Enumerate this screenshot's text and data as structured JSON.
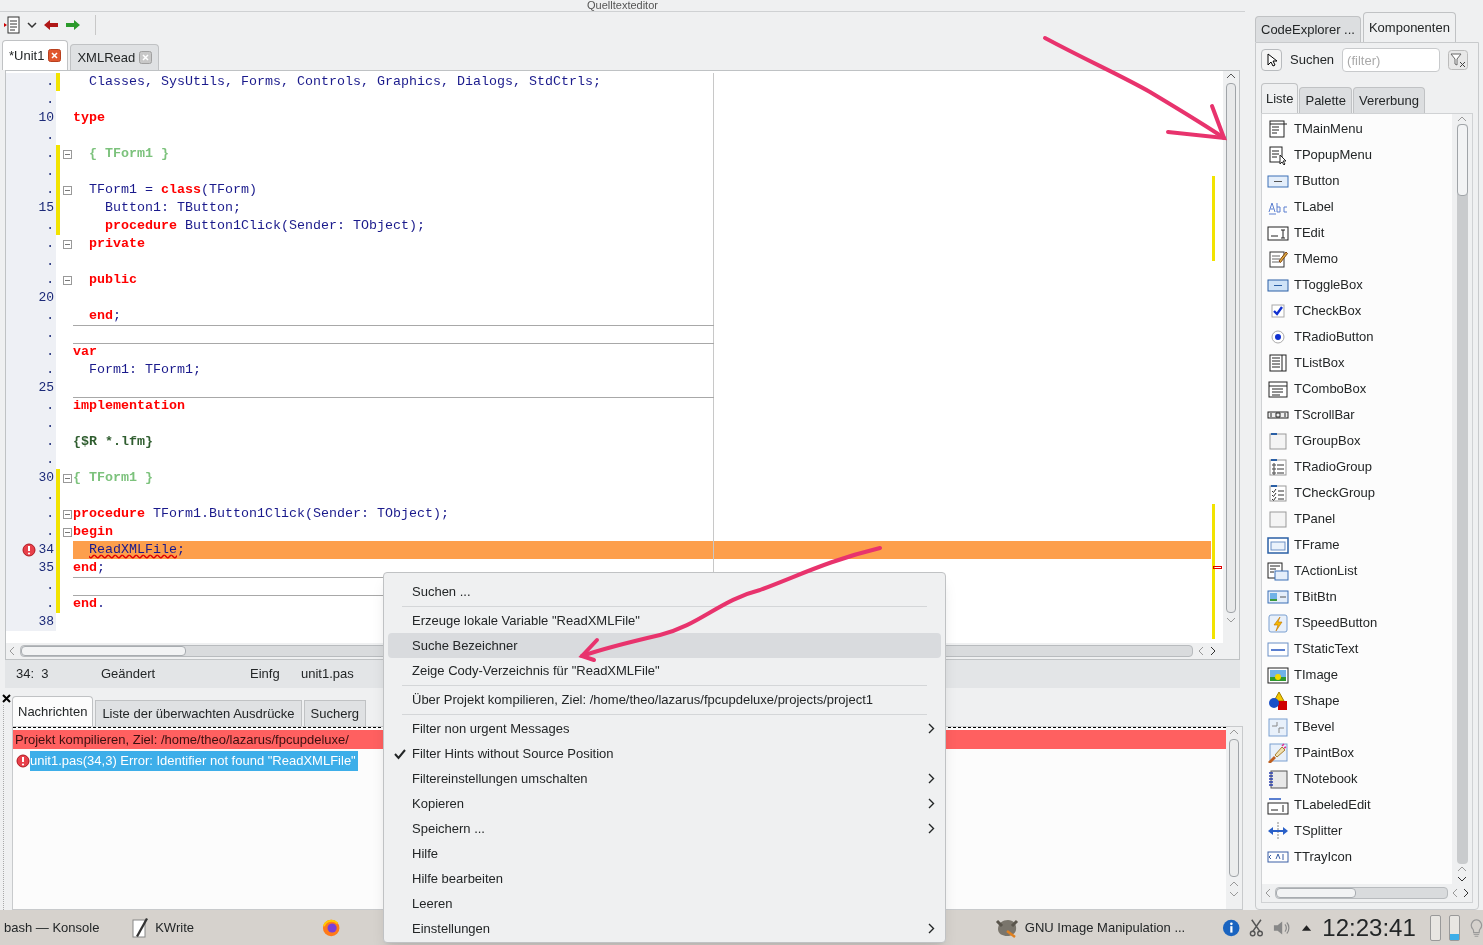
{
  "editor_window": {
    "title": "Quelltexteditor"
  },
  "editor_tabs": [
    {
      "label": "*Unit1",
      "selected": true
    },
    {
      "label": "XMLRead",
      "selected": false
    }
  ],
  "code_lines": [
    {
      "number": ".",
      "modified": true,
      "error": false,
      "fold": false,
      "rule_above": false,
      "segments": [
        {
          "text": "  Classes, SysUtils, Forms, Controls, Graphics, Dialogs, StdCtrls;",
          "kind": "id"
        }
      ]
    },
    {
      "number": ".",
      "modified": false,
      "error": false,
      "fold": false,
      "rule_above": false
    },
    {
      "number": "10",
      "modified": false,
      "error": false,
      "fold": false,
      "rule_above": false,
      "segments": [
        {
          "text": "type",
          "kind": "kw"
        }
      ]
    },
    {
      "number": ".",
      "modified": false,
      "error": false,
      "fold": false,
      "rule_above": false
    },
    {
      "number": ".",
      "modified": true,
      "error": false,
      "fold": true,
      "rule_above": false,
      "segments": [
        {
          "text": "  { TForm1 }",
          "kind": "comment"
        }
      ]
    },
    {
      "number": ".",
      "modified": true,
      "error": false,
      "fold": false,
      "rule_above": false
    },
    {
      "number": ".",
      "modified": true,
      "error": false,
      "fold": true,
      "rule_above": false,
      "segments": [
        {
          "text": "  TForm1 = ",
          "kind": "id"
        },
        {
          "text": "class",
          "kind": "kw"
        },
        {
          "text": "(TForm)",
          "kind": "id"
        }
      ]
    },
    {
      "number": "15",
      "modified": true,
      "error": false,
      "fold": false,
      "rule_above": false,
      "segments": [
        {
          "text": "    Button1: TButton;",
          "kind": "id"
        }
      ]
    },
    {
      "number": ".",
      "modified": true,
      "error": false,
      "fold": false,
      "rule_above": false,
      "segments": [
        {
          "text": "    procedure",
          "kind": "kw"
        },
        {
          "text": " Button1Click(Sender: TObject);",
          "kind": "id"
        }
      ]
    },
    {
      "number": ".",
      "modified": false,
      "error": false,
      "fold": true,
      "rule_above": false,
      "segments": [
        {
          "text": "  private",
          "kind": "kw"
        }
      ]
    },
    {
      "number": ".",
      "modified": false,
      "error": false,
      "fold": false,
      "rule_above": false
    },
    {
      "number": ".",
      "modified": false,
      "error": false,
      "fold": true,
      "rule_above": false,
      "segments": [
        {
          "text": "  public",
          "kind": "kw"
        }
      ]
    },
    {
      "number": "20",
      "modified": false,
      "error": false,
      "fold": false,
      "rule_above": false
    },
    {
      "number": ".",
      "modified": false,
      "error": false,
      "fold": false,
      "rule_above": false,
      "segments": [
        {
          "text": "  end",
          "kind": "kw"
        },
        {
          "text": ";",
          "kind": "id"
        }
      ]
    },
    {
      "number": ".",
      "modified": false,
      "error": false,
      "fold": false,
      "rule_above": true
    },
    {
      "number": ".",
      "modified": false,
      "error": false,
      "fold": false,
      "rule_above": true,
      "segments": [
        {
          "text": "var",
          "kind": "kw"
        }
      ]
    },
    {
      "number": ".",
      "modified": false,
      "error": false,
      "fold": false,
      "rule_above": false,
      "segments": [
        {
          "text": "  Form1: TForm1;",
          "kind": "id"
        }
      ]
    },
    {
      "number": "25",
      "modified": false,
      "error": false,
      "fold": false,
      "rule_above": false
    },
    {
      "number": ".",
      "modified": false,
      "error": false,
      "fold": false,
      "rule_above": true,
      "segments": [
        {
          "text": "implementation",
          "kind": "kw"
        }
      ]
    },
    {
      "number": ".",
      "modified": false,
      "error": false,
      "fold": false,
      "rule_above": false
    },
    {
      "number": ".",
      "modified": false,
      "error": false,
      "fold": false,
      "rule_above": false,
      "segments": [
        {
          "text": "{$R *.lfm}",
          "kind": "directive"
        }
      ]
    },
    {
      "number": ".",
      "modified": false,
      "error": false,
      "fold": false,
      "rule_above": false
    },
    {
      "number": "30",
      "modified": true,
      "error": false,
      "fold": true,
      "rule_above": false,
      "segments": [
        {
          "text": "{ TForm1 }",
          "kind": "comment"
        }
      ]
    },
    {
      "number": ".",
      "modified": true,
      "error": false,
      "fold": false,
      "rule_above": false
    },
    {
      "number": ".",
      "modified": true,
      "error": false,
      "fold": true,
      "rule_above": false,
      "segments": [
        {
          "text": "procedure",
          "kind": "kw"
        },
        {
          "text": " TForm1.Button1Click(Sender: TObject);",
          "kind": "id"
        }
      ]
    },
    {
      "number": ".",
      "modified": true,
      "error": false,
      "fold": true,
      "rule_above": false,
      "segments": [
        {
          "text": "begin",
          "kind": "kw"
        }
      ]
    },
    {
      "number": "34",
      "modified": true,
      "error": true,
      "fold": false,
      "rule_above": false,
      "segments": [
        {
          "text": "  ReadXMLFile",
          "kind": "error_id"
        },
        {
          "text": ";",
          "kind": "id"
        }
      ]
    },
    {
      "number": "35",
      "modified": true,
      "error": false,
      "fold": false,
      "rule_above": false,
      "segments": [
        {
          "text": "end",
          "kind": "kw"
        },
        {
          "text": ";",
          "kind": "id"
        }
      ]
    },
    {
      "number": ".",
      "modified": true,
      "error": false,
      "fold": false,
      "rule_above": true
    },
    {
      "number": ".",
      "modified": true,
      "error": false,
      "fold": false,
      "rule_above": true,
      "segments": [
        {
          "text": "end",
          "kind": "kw"
        },
        {
          "text": ".",
          "kind": "id"
        }
      ]
    },
    {
      "number": "38",
      "modified": false,
      "error": false,
      "fold": false,
      "rule_above": false
    }
  ],
  "status_bar": {
    "position": "34:  3",
    "state": "Geändert",
    "mode": "Einfg",
    "file": "unit1.pas"
  },
  "messages": {
    "tabs": [
      {
        "label": "Nachrichten",
        "selected": true
      },
      {
        "label": "Liste der überwachten Ausdrücke",
        "selected": false
      },
      {
        "label": "Sucherg",
        "selected": false
      }
    ],
    "rows": [
      {
        "kind": "header",
        "text": "Projekt kompilieren, Ziel: /home/theo/lazarus/fpcupdeluxe/",
        "selected": false
      },
      {
        "kind": "error",
        "text": "unit1.pas(34,3) Error: Identifier not found \"ReadXMLFile\"",
        "selected": true
      }
    ]
  },
  "context_menu": [
    {
      "kind": "item",
      "label": "Suchen ...",
      "selected": false,
      "checked": false,
      "submenu": false
    },
    {
      "kind": "separator"
    },
    {
      "kind": "item",
      "label": "Erzeuge lokale Variable \"ReadXMLFile\"",
      "selected": false,
      "checked": false,
      "submenu": false
    },
    {
      "kind": "item",
      "label": "Suche Bezeichner",
      "selected": true,
      "checked": false,
      "submenu": false
    },
    {
      "kind": "item",
      "label": "Zeige Cody-Verzeichnis für \"ReadXMLFile\"",
      "selected": false,
      "checked": false,
      "submenu": false
    },
    {
      "kind": "separator"
    },
    {
      "kind": "item",
      "label": "Über Projekt kompilieren, Ziel: /home/theo/lazarus/fpcupdeluxe/projects/project1",
      "selected": false,
      "checked": false,
      "submenu": false
    },
    {
      "kind": "separator"
    },
    {
      "kind": "item",
      "label": "Filter non urgent Messages",
      "selected": false,
      "checked": false,
      "submenu": true
    },
    {
      "kind": "item",
      "label": "Filter Hints without Source Position",
      "selected": false,
      "checked": true,
      "submenu": false
    },
    {
      "kind": "item",
      "label": "Filtereinstellungen umschalten",
      "selected": false,
      "checked": false,
      "submenu": true
    },
    {
      "kind": "item",
      "label": "Kopieren",
      "selected": false,
      "checked": false,
      "submenu": true
    },
    {
      "kind": "item",
      "label": "Speichern ...",
      "selected": false,
      "checked": false,
      "submenu": true
    },
    {
      "kind": "item",
      "label": "Hilfe",
      "selected": false,
      "checked": false,
      "submenu": false
    },
    {
      "kind": "item",
      "label": "Hilfe bearbeiten",
      "selected": false,
      "checked": false,
      "submenu": false
    },
    {
      "kind": "item",
      "label": "Leeren",
      "selected": false,
      "checked": false,
      "submenu": false
    },
    {
      "kind": "item",
      "label": "Einstellungen",
      "selected": false,
      "checked": false,
      "submenu": true
    }
  ],
  "side_panel": {
    "tabs": [
      {
        "label": "CodeExplorer ...",
        "selected": false
      },
      {
        "label": "Komponenten",
        "selected": true
      }
    ],
    "search_label": "Suchen",
    "filter": {
      "placeholder": "(filter)"
    },
    "subtabs": [
      {
        "label": "Liste",
        "selected": true
      },
      {
        "label": "Palette",
        "selected": false
      },
      {
        "label": "Vererbung",
        "selected": false
      }
    ],
    "components": [
      {
        "name": "TMainMenu",
        "selected": false
      },
      {
        "name": "TPopupMenu",
        "selected": false
      },
      {
        "name": "TButton",
        "selected": false
      },
      {
        "name": "TLabel",
        "selected": false
      },
      {
        "name": "TEdit",
        "selected": false
      },
      {
        "name": "TMemo",
        "selected": false
      },
      {
        "name": "TToggleBox",
        "selected": false
      },
      {
        "name": "TCheckBox",
        "selected": false
      },
      {
        "name": "TRadioButton",
        "selected": false
      },
      {
        "name": "TListBox",
        "selected": false
      },
      {
        "name": "TComboBox",
        "selected": false
      },
      {
        "name": "TScrollBar",
        "selected": false
      },
      {
        "name": "TGroupBox",
        "selected": false
      },
      {
        "name": "TRadioGroup",
        "selected": false
      },
      {
        "name": "TCheckGroup",
        "selected": false
      },
      {
        "name": "TPanel",
        "selected": false
      },
      {
        "name": "TFrame",
        "selected": false
      },
      {
        "name": "TActionList",
        "selected": false
      },
      {
        "name": "TBitBtn",
        "selected": false
      },
      {
        "name": "TSpeedButton",
        "selected": false
      },
      {
        "name": "TStaticText",
        "selected": false
      },
      {
        "name": "TImage",
        "selected": false
      },
      {
        "name": "TShape",
        "selected": false
      },
      {
        "name": "TBevel",
        "selected": false
      },
      {
        "name": "TPaintBox",
        "selected": false
      },
      {
        "name": "TNotebook",
        "selected": false
      },
      {
        "name": "TLabeledEdit",
        "selected": false
      },
      {
        "name": "TSplitter",
        "selected": false
      },
      {
        "name": "TTrayIcon",
        "selected": false
      }
    ]
  },
  "taskbar": {
    "tasks": [
      {
        "label": "bash — Konsole"
      },
      {
        "label": "KWrite"
      },
      {
        "label": "GNU Image Manipulation ..."
      }
    ],
    "clock": "12:23:41"
  }
}
